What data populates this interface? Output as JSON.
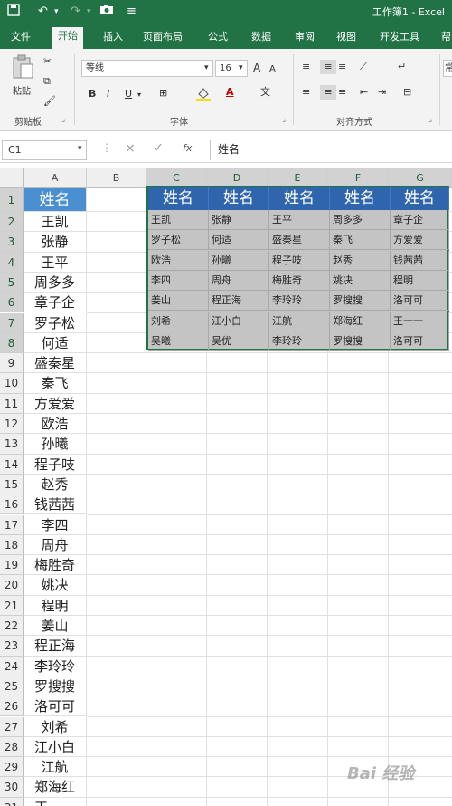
{
  "title_bar": {
    "save_icon": "save-icon",
    "undo_icon": "undo-icon",
    "redo_icon": "redo-icon",
    "camera_icon": "camera-icon",
    "title": "工作簿1 - Excel"
  },
  "tabs": [
    "文件",
    "开始",
    "插入",
    "页面布局",
    "公式",
    "数据",
    "审阅",
    "视图",
    "开发工具",
    "帮"
  ],
  "active_tab": "开始",
  "ribbon": {
    "clipboard": {
      "paste_label": "粘贴",
      "group_label": "剪贴板"
    },
    "font": {
      "font_name": "等线",
      "font_size": "16",
      "grow": "A",
      "shrink": "A",
      "bold": "B",
      "italic": "I",
      "underline": "U",
      "font_color_letter": "A",
      "group_label": "字体"
    },
    "alignment": {
      "group_label": "对齐方式"
    },
    "number": {
      "format_letter": "常"
    }
  },
  "formula_bar": {
    "cell_ref": "C1",
    "fx": "fx",
    "cancel": "×",
    "enter": "✓",
    "content": "姓名"
  },
  "columns": [
    "A",
    "B",
    "C",
    "D",
    "E",
    "F",
    "G"
  ],
  "rows": [
    "1",
    "2",
    "3",
    "4",
    "5",
    "6",
    "7",
    "8",
    "9",
    "10",
    "11",
    "12",
    "13",
    "14",
    "15",
    "16",
    "17",
    "18",
    "19",
    "20",
    "21",
    "22",
    "23",
    "24",
    "25",
    "26",
    "27",
    "28",
    "29",
    "30",
    "31"
  ],
  "column_a": [
    "姓名",
    "王凯",
    "张静",
    "王平",
    "周多多",
    "章子企",
    "罗子松",
    "何适",
    "盛秦星",
    "秦飞",
    "方爱爱",
    "欧浩",
    "孙曦",
    "程子吱",
    "赵秀",
    "钱茜茜",
    "李四",
    "周舟",
    "梅胜奇",
    "姚决",
    "程明",
    "姜山",
    "程正海",
    "李玲玲",
    "罗搜搜",
    "洛可可",
    "刘希",
    "江小白",
    "江航",
    "郑海红",
    "王一一"
  ],
  "range_header": [
    "姓名",
    "姓名",
    "姓名",
    "姓名",
    "姓名"
  ],
  "range_rows": [
    [
      "王凯",
      "张静",
      "王平",
      "周多多",
      "章子企"
    ],
    [
      "罗子松",
      "何适",
      "盛秦星",
      "秦飞",
      "方爱爱"
    ],
    [
      "欧浩",
      "孙曦",
      "程子吱",
      "赵秀",
      "钱茜茜"
    ],
    [
      "李四",
      "周舟",
      "梅胜奇",
      "姚决",
      "程明"
    ],
    [
      "姜山",
      "程正海",
      "李玲玲",
      "罗搜搜",
      "洛可可"
    ],
    [
      "刘希",
      "江小白",
      "江航",
      "郑海红",
      "王一一"
    ],
    [
      "吴曦",
      "吴优",
      "李玲玲",
      "罗搜搜",
      "洛可可"
    ]
  ],
  "watermark": "Bai 经验",
  "colors": {
    "excel_green": "#217346",
    "header_blue": "#2f65ad",
    "cell_blue": "#4a8fd0",
    "selection_gray": "#c4c4c4"
  }
}
